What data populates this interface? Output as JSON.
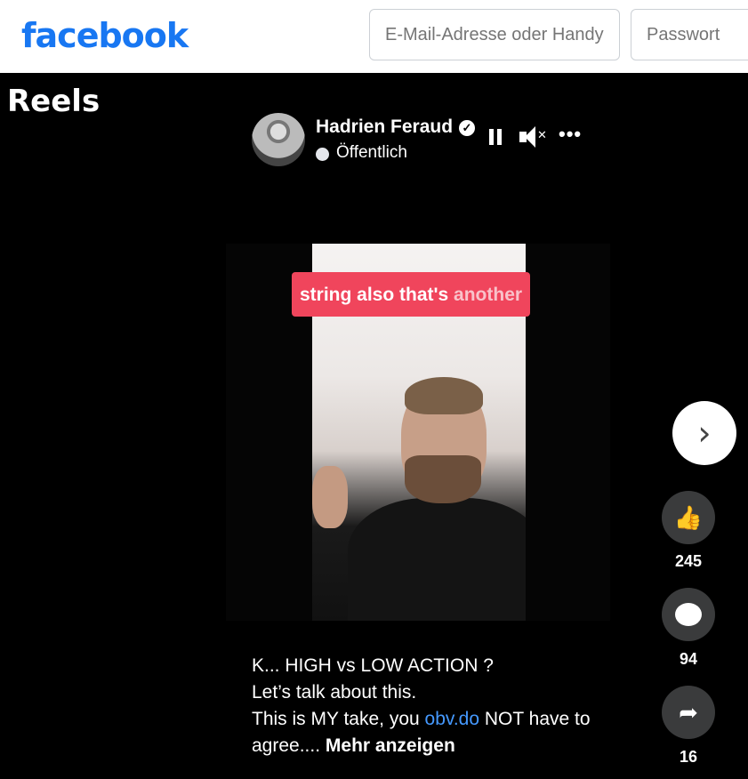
{
  "header": {
    "logo": "facebook",
    "email_placeholder": "E-Mail-Adresse oder Handynummer",
    "password_placeholder": "Passwort"
  },
  "page": {
    "title": "Reels"
  },
  "reel": {
    "author": "Hadrien Feraud",
    "verified_icon": "verified-badge-icon",
    "visibility": "Öffentlich",
    "caption_part1": "string also that's",
    "caption_part2": "another",
    "description_line1": "K... HIGH vs LOW ACTION ?",
    "description_line2": "Let’s talk about this.",
    "description_line3_pre": "This is MY take, you ",
    "description_link": "obv.do",
    "description_line3_post": " NOT have to agree....",
    "show_more": "Mehr anzeigen"
  },
  "actions": {
    "likes": "245",
    "comments": "94",
    "shares": "16"
  },
  "colors": {
    "brand": "#1877f2",
    "caption_bg": "#f0455c",
    "link": "#4599ff"
  }
}
